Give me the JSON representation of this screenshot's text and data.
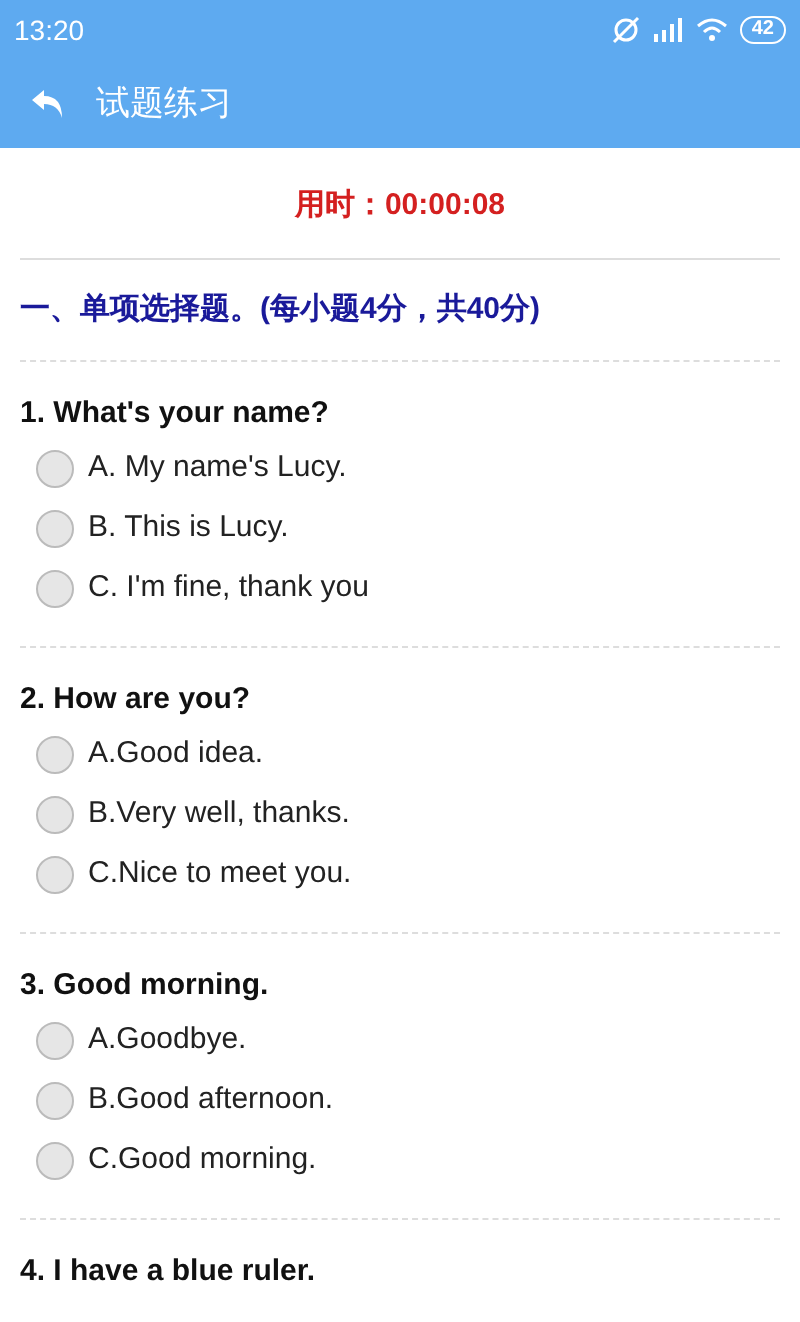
{
  "status_bar": {
    "time": "13:20",
    "battery": "42"
  },
  "header": {
    "title": "试题练习"
  },
  "timer": "用时：00:00:08",
  "section": "一、单项选择题。(每小题4分，共40分)",
  "questions": [
    {
      "title": "1. What's your name?",
      "options": [
        {
          "label": "A. My name's Lucy.",
          "selected": false
        },
        {
          "label": "B. This is Lucy.",
          "selected": false
        },
        {
          "label": "C. I'm fine, thank you",
          "selected": false
        }
      ]
    },
    {
      "title": "2. How are you?",
      "options": [
        {
          "label": "A.Good idea.",
          "selected": false
        },
        {
          "label": "B.Very well, thanks.",
          "selected": false
        },
        {
          "label": "C.Nice to meet you.",
          "selected": false
        }
      ]
    },
    {
      "title": "3. Good morning.",
      "options": [
        {
          "label": "A.Goodbye.",
          "selected": false
        },
        {
          "label": "B.Good afternoon.",
          "selected": false
        },
        {
          "label": "C.Good morning.",
          "selected": false
        }
      ]
    },
    {
      "title": "4. I have a blue ruler."
    }
  ]
}
